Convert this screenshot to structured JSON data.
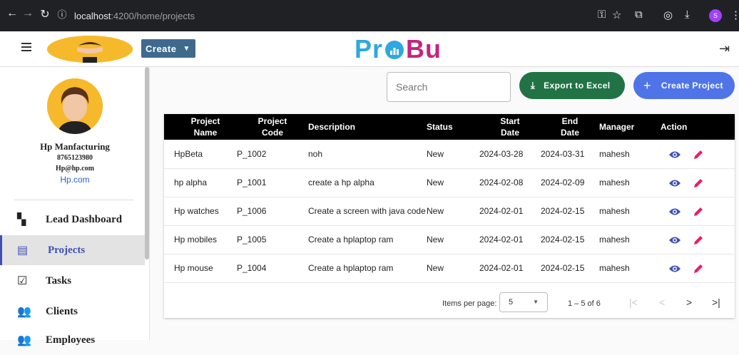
{
  "browser": {
    "url_host": "localhost",
    "url_path": ":4200/home/projects",
    "profile_initial": "S"
  },
  "header": {
    "create_label": "Create",
    "brand_left": "Pr",
    "brand_right": "Bu"
  },
  "sidebar": {
    "org_name": "Hp Manfacturing",
    "phone": "8765123980",
    "email": "Hp@hp.com",
    "site": "Hp.com",
    "items": [
      {
        "label": "Lead Dashboard",
        "icon": "dashboard-icon"
      },
      {
        "label": "Projects",
        "icon": "assignment-icon",
        "active": true
      },
      {
        "label": "Tasks",
        "icon": "task-icon"
      },
      {
        "label": "Clients",
        "icon": "people-icon"
      },
      {
        "label": "Employees",
        "icon": "group-icon"
      }
    ]
  },
  "toolbar": {
    "search_placeholder": "Search",
    "export_label": "Export to Excel",
    "create_project_label": "Create Project"
  },
  "table": {
    "headers": {
      "name_1": "Project",
      "name_2": "Name",
      "code_1": "Project",
      "code_2": "Code",
      "description": "Description",
      "status": "Status",
      "start_1": "Start",
      "start_2": "Date",
      "end_1": "End",
      "end_2": "Date",
      "manager": "Manager",
      "action": "Action"
    },
    "rows": [
      {
        "name": "HpBeta",
        "code": "P_1002",
        "description": "noh",
        "status": "New",
        "start": "2024-03-28",
        "end": "2024-03-31",
        "manager": "mahesh"
      },
      {
        "name": "hp alpha",
        "code": "P_1001",
        "description": "create a hp alpha",
        "status": "New",
        "start": "2024-02-08",
        "end": "2024-02-09",
        "manager": "mahesh"
      },
      {
        "name": "Hp watches",
        "code": "P_1006",
        "description": "Create a screen with java code",
        "status": "New",
        "start": "2024-02-01",
        "end": "2024-02-15",
        "manager": "mahesh"
      },
      {
        "name": "Hp mobiles",
        "code": "P_1005",
        "description": "Create a hplaptop ram",
        "status": "New",
        "start": "2024-02-01",
        "end": "2024-02-15",
        "manager": "mahesh"
      },
      {
        "name": "Hp mouse",
        "code": "P_1004",
        "description": "Create a hplaptop ram",
        "status": "New",
        "start": "2024-02-01",
        "end": "2024-02-15",
        "manager": "mahesh"
      }
    ]
  },
  "paginator": {
    "items_per_page_label": "Items per page:",
    "page_size": "5",
    "range_label": "1 – 5 of 6"
  },
  "colors": {
    "export_green": "#217346",
    "create_blue": "#4f74e8",
    "view_icon": "#3f51b5",
    "edit_icon": "#e91e63"
  }
}
